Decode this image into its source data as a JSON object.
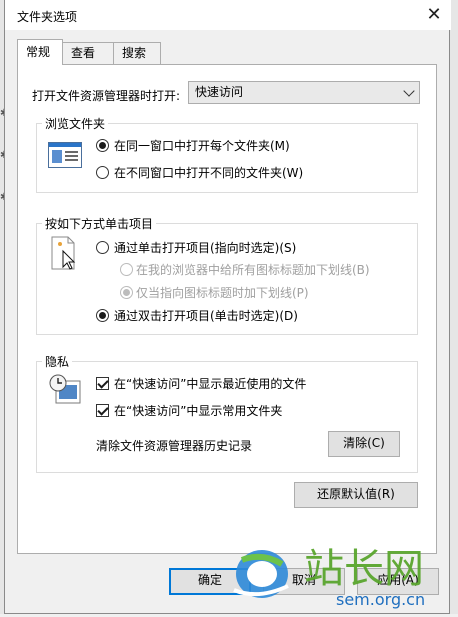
{
  "window": {
    "title": "文件夹选项",
    "close_glyph": "✕"
  },
  "tabs": [
    {
      "label": "常规",
      "active": true
    },
    {
      "label": "查看",
      "active": false
    },
    {
      "label": "搜索",
      "active": false
    }
  ],
  "open_explorer": {
    "label": "打开文件资源管理器时打开:",
    "value": "快速访问"
  },
  "browse_folders": {
    "title": "浏览文件夹",
    "options": [
      {
        "label": "在同一窗口中打开每个文件夹(M)",
        "checked": true
      },
      {
        "label": "在不同窗口中打开不同的文件夹(W)",
        "checked": false
      }
    ]
  },
  "click_items": {
    "title": "按如下方式单击项目",
    "options": [
      {
        "label": "通过单击打开项目(指向时选定)(S)",
        "checked": false,
        "enabled": true
      },
      {
        "label": "在我的浏览器中给所有图标标题加下划线(B)",
        "checked": false,
        "enabled": false
      },
      {
        "label": "仅当指向图标标题时加下划线(P)",
        "checked": true,
        "enabled": false
      },
      {
        "label": "通过双击打开项目(单击时选定)(D)",
        "checked": true,
        "enabled": true
      }
    ]
  },
  "privacy": {
    "title": "隐私",
    "checkboxes": [
      {
        "label": "在“快速访问”中显示最近使用的文件",
        "checked": true
      },
      {
        "label": "在“快速访问”中显示常用文件夹",
        "checked": true
      }
    ],
    "clear_history_label": "清除文件资源管理器历史记录",
    "clear_button": "清除(C)"
  },
  "restore_defaults_button": "还原默认值(R)",
  "footer": {
    "ok_button": "确定",
    "cancel_button": "取消",
    "apply_button": "应用(A)"
  },
  "watermark": {
    "site": "sem.org.cn"
  }
}
